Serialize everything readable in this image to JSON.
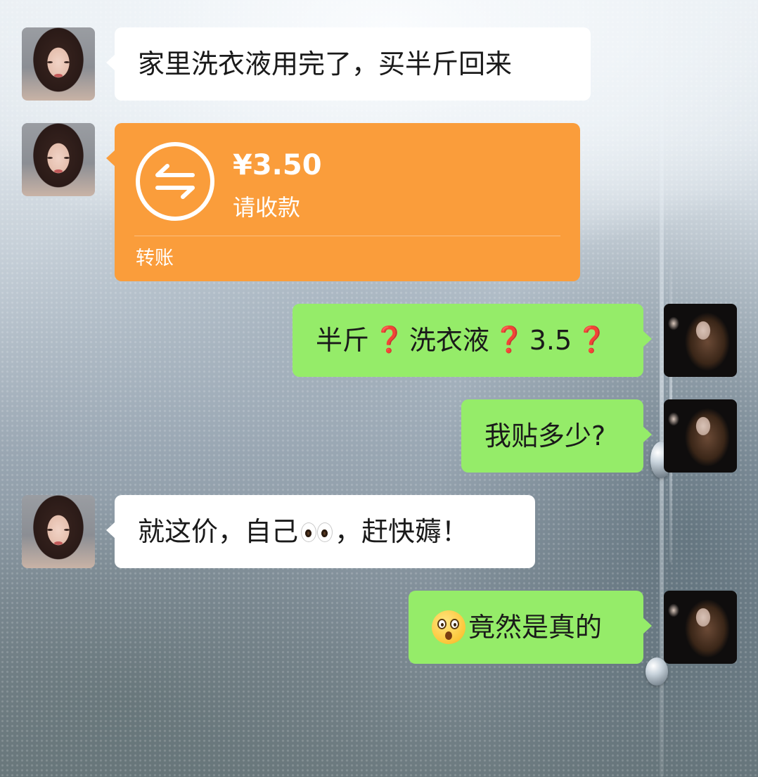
{
  "messages": [
    {
      "side": "left",
      "text": "家里洗衣液用完了，买半斤回来"
    },
    {
      "side": "left",
      "type": "transfer",
      "amount": "¥3.50",
      "status": "请收款",
      "kind": "转账",
      "icon": "transfer-arrows-icon",
      "card_color": "#fa9d3b"
    },
    {
      "side": "right",
      "parts": [
        "半斤",
        "❓",
        "洗衣液",
        "❓",
        "3.5",
        "❓"
      ]
    },
    {
      "side": "right",
      "text": "我贴多少?"
    },
    {
      "side": "left",
      "parts": [
        "就这价，自己",
        "👀",
        "，赶快薅！"
      ]
    },
    {
      "side": "right",
      "parts": [
        "😲",
        "竟然是真的"
      ]
    }
  ],
  "colors": {
    "bubble_left": "#ffffff",
    "bubble_right": "#95ec69",
    "question_mark": "#e02a2a"
  }
}
